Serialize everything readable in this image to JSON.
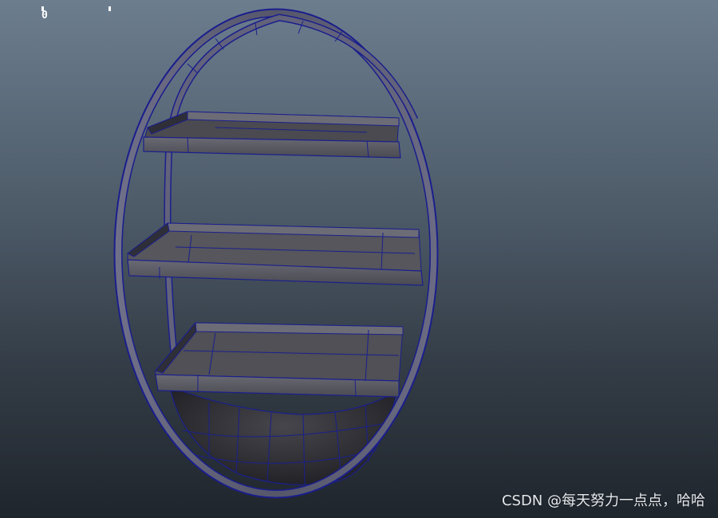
{
  "viewport": {
    "model": "round-wall-shelf-wireframe",
    "shading": "smooth-shade-with-wireframe",
    "background_top": "#6c7d8e",
    "background_bottom": "#1f252c",
    "wire_color": "#1b1f8c",
    "surface_color": "#5c5c62"
  },
  "hud": {
    "poly_count_value": "0"
  },
  "watermark": {
    "text": "CSDN @每天努力一点点，哈哈"
  }
}
